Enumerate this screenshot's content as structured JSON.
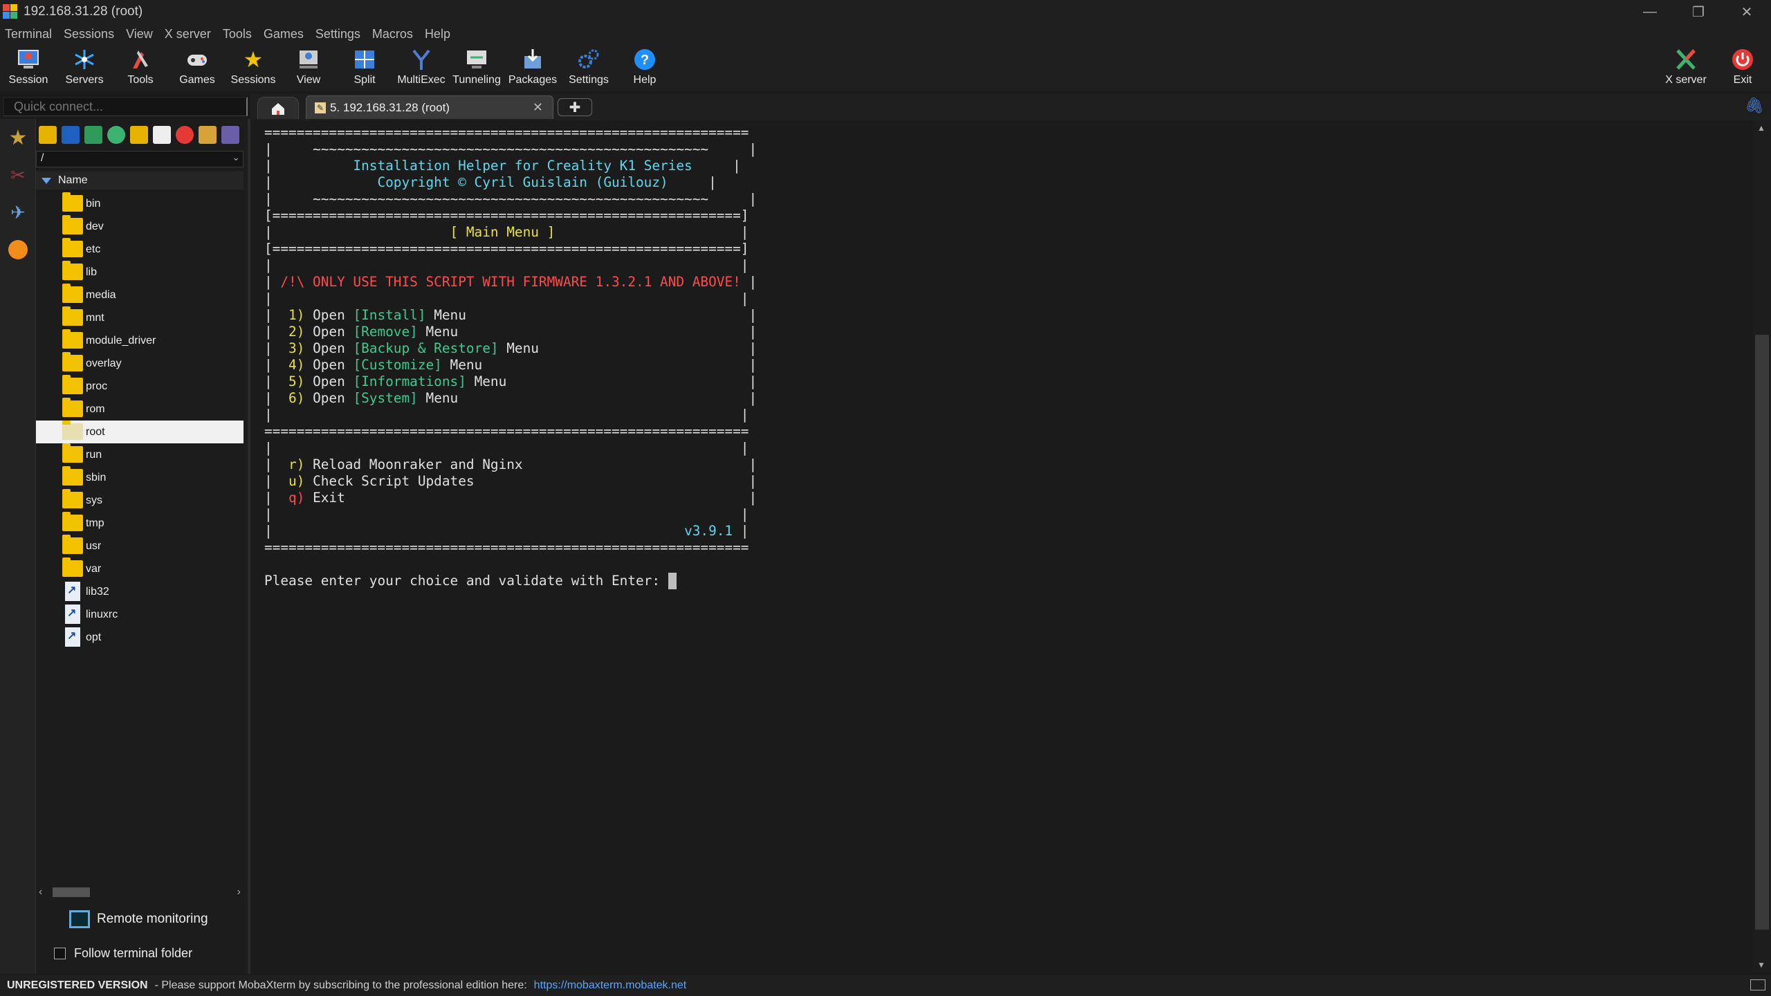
{
  "window": {
    "title": "192.168.31.28 (root)"
  },
  "menu": [
    "Terminal",
    "Sessions",
    "View",
    "X server",
    "Tools",
    "Games",
    "Settings",
    "Macros",
    "Help"
  ],
  "toolbar": {
    "buttons": [
      {
        "label": "Session",
        "icon": "session-icon"
      },
      {
        "label": "Servers",
        "icon": "servers-icon"
      },
      {
        "label": "Tools",
        "icon": "tools-icon"
      },
      {
        "label": "Games",
        "icon": "games-icon"
      },
      {
        "label": "Sessions",
        "icon": "sessions-star-icon"
      },
      {
        "label": "View",
        "icon": "view-icon"
      },
      {
        "label": "Split",
        "icon": "split-icon"
      },
      {
        "label": "MultiExec",
        "icon": "multiexec-icon"
      },
      {
        "label": "Tunneling",
        "icon": "tunneling-icon"
      },
      {
        "label": "Packages",
        "icon": "packages-icon"
      },
      {
        "label": "Settings",
        "icon": "settings-gears-icon"
      },
      {
        "label": "Help",
        "icon": "help-icon"
      }
    ],
    "right": [
      {
        "label": "X server",
        "icon": "xserver-icon"
      },
      {
        "label": "Exit",
        "icon": "power-icon"
      }
    ]
  },
  "quick_connect": {
    "placeholder": "Quick connect..."
  },
  "tabs": {
    "session_tab": "5. 192.168.31.28 (root)"
  },
  "sftp": {
    "path": "/",
    "column": "Name",
    "files": [
      {
        "name": "bin",
        "type": "folder"
      },
      {
        "name": "dev",
        "type": "folder"
      },
      {
        "name": "etc",
        "type": "folder"
      },
      {
        "name": "lib",
        "type": "folder"
      },
      {
        "name": "media",
        "type": "folder"
      },
      {
        "name": "mnt",
        "type": "folder"
      },
      {
        "name": "module_driver",
        "type": "folder"
      },
      {
        "name": "overlay",
        "type": "folder"
      },
      {
        "name": "proc",
        "type": "folder"
      },
      {
        "name": "rom",
        "type": "folder"
      },
      {
        "name": "root",
        "type": "folder",
        "selected": true
      },
      {
        "name": "run",
        "type": "folder"
      },
      {
        "name": "sbin",
        "type": "folder"
      },
      {
        "name": "sys",
        "type": "folder"
      },
      {
        "name": "tmp",
        "type": "folder"
      },
      {
        "name": "usr",
        "type": "folder"
      },
      {
        "name": "var",
        "type": "folder"
      },
      {
        "name": "lib32",
        "type": "link"
      },
      {
        "name": "linuxrc",
        "type": "link"
      },
      {
        "name": "opt",
        "type": "link"
      }
    ],
    "remote_monitoring": "Remote monitoring",
    "follow_folder": "Follow terminal folder"
  },
  "terminal": {
    "lines": [
      [
        [
          "============================================================",
          "w"
        ]
      ],
      [
        [
          "|     ",
          "w"
        ],
        [
          "~~~~~~~~~~~~~~~~~~~~~~~~~~~~~~~~~~~~~~~~~~~~~~~~~",
          "w"
        ],
        [
          "     |",
          "w"
        ]
      ],
      [
        [
          "|     ",
          "w"
        ],
        [
          "     Installation Helper for Creality K1 Series",
          "cyan"
        ],
        [
          "     |",
          "w"
        ]
      ],
      [
        [
          "|     ",
          "w"
        ],
        [
          "        Copyright © Cyril Guislain (Guilouz)",
          "cyan"
        ],
        [
          "     |",
          "w"
        ]
      ],
      [
        [
          "|     ",
          "w"
        ],
        [
          "~~~~~~~~~~~~~~~~~~~~~~~~~~~~~~~~~~~~~~~~~~~~~~~~~",
          "w"
        ],
        [
          "     |",
          "w"
        ]
      ],
      [
        [
          "[==========================================================]",
          "w"
        ]
      ],
      [
        [
          "|                      ",
          "w"
        ],
        [
          "[ Main Menu ]",
          "yel"
        ],
        [
          "                       |",
          "w"
        ]
      ],
      [
        [
          "[==========================================================]",
          "w"
        ]
      ],
      [
        [
          "|                                                          |",
          "w"
        ]
      ],
      [
        [
          "| ",
          "w"
        ],
        [
          "/!\\ ONLY USE THIS SCRIPT WITH FIRMWARE 1.3.2.1 AND ABOVE!",
          "red"
        ],
        [
          " |",
          "w"
        ]
      ],
      [
        [
          "|                                                          |",
          "w"
        ]
      ],
      [
        [
          "|  ",
          "w"
        ],
        [
          "1)",
          "yel"
        ],
        [
          " Open ",
          "w"
        ],
        [
          "[Install]",
          "grn"
        ],
        [
          " Menu                                   |",
          "w"
        ]
      ],
      [
        [
          "|  ",
          "w"
        ],
        [
          "2)",
          "yel"
        ],
        [
          " Open ",
          "w"
        ],
        [
          "[Remove]",
          "grn"
        ],
        [
          " Menu                                    |",
          "w"
        ]
      ],
      [
        [
          "|  ",
          "w"
        ],
        [
          "3)",
          "yel"
        ],
        [
          " Open ",
          "w"
        ],
        [
          "[Backup & Restore]",
          "grn"
        ],
        [
          " Menu                          |",
          "w"
        ]
      ],
      [
        [
          "|  ",
          "w"
        ],
        [
          "4)",
          "yel"
        ],
        [
          " Open ",
          "w"
        ],
        [
          "[Customize]",
          "grn"
        ],
        [
          " Menu                                 |",
          "w"
        ]
      ],
      [
        [
          "|  ",
          "w"
        ],
        [
          "5)",
          "yel"
        ],
        [
          " Open ",
          "w"
        ],
        [
          "[Informations]",
          "grn"
        ],
        [
          " Menu                              |",
          "w"
        ]
      ],
      [
        [
          "|  ",
          "w"
        ],
        [
          "6)",
          "yel"
        ],
        [
          " Open ",
          "w"
        ],
        [
          "[System]",
          "grn"
        ],
        [
          " Menu                                    |",
          "w"
        ]
      ],
      [
        [
          "|                                                          |",
          "w"
        ]
      ],
      [
        [
          "============================================================",
          "w"
        ]
      ],
      [
        [
          "|                                                          |",
          "w"
        ]
      ],
      [
        [
          "|  ",
          "w"
        ],
        [
          "r)",
          "yel"
        ],
        [
          " Reload Moonraker and Nginx                            |",
          "w"
        ]
      ],
      [
        [
          "|  ",
          "w"
        ],
        [
          "u)",
          "yel"
        ],
        [
          " Check Script Updates                                  |",
          "w"
        ]
      ],
      [
        [
          "|  ",
          "w"
        ],
        [
          "q)",
          "red"
        ],
        [
          " Exit                                                  |",
          "w"
        ]
      ],
      [
        [
          "|                                                          |",
          "w"
        ]
      ],
      [
        [
          "|                                                   ",
          "w"
        ],
        [
          "v3.9.1",
          "cyan"
        ],
        [
          " |",
          "w"
        ]
      ],
      [
        [
          "============================================================",
          "w"
        ]
      ],
      [
        [
          "",
          "w"
        ]
      ],
      [
        [
          "Please enter your choice and validate with Enter: ",
          "w"
        ]
      ]
    ]
  },
  "status": {
    "unregistered": "UNREGISTERED VERSION",
    "message": "-  Please support MobaXterm by subscribing to the professional edition here:",
    "url": "https://mobaxterm.mobatek.net"
  }
}
